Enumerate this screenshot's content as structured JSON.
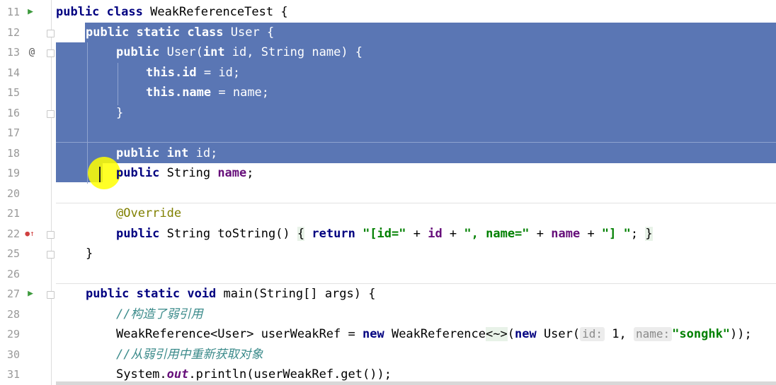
{
  "editor": {
    "lines": [
      {
        "num": "11"
      },
      {
        "num": "12"
      },
      {
        "num": "13"
      },
      {
        "num": "14"
      },
      {
        "num": "15"
      },
      {
        "num": "16"
      },
      {
        "num": "17"
      },
      {
        "num": "18"
      },
      {
        "num": "19"
      },
      {
        "num": "20"
      },
      {
        "num": "21"
      },
      {
        "num": "22"
      },
      {
        "num": "25"
      },
      {
        "num": "26"
      },
      {
        "num": "27"
      },
      {
        "num": "28"
      },
      {
        "num": "29"
      },
      {
        "num": "30"
      },
      {
        "num": "31"
      }
    ],
    "gutter_icons": {
      "run_11": "▶",
      "override_13": "@",
      "run_27": "▶",
      "override_22": "●↑"
    },
    "code": {
      "l11_public": "public",
      "l11_class": "class",
      "l11_name": " WeakReferenceTest {",
      "l12_public": "public",
      "l12_static": "static",
      "l12_class": "class",
      "l12_name": " User {",
      "l13_public": "public",
      "l13_sig1": " User(",
      "l13_int": "int",
      "l13_sig2": " id, String name) {",
      "l14_this": "this",
      "l14_id": ".id",
      "l14_rest": " = id;",
      "l15_this": "this",
      "l15_name": ".name",
      "l15_rest": " = name;",
      "l16_brace": "}",
      "l18_public": "public",
      "l18_int": "int",
      "l18_id": " id;",
      "l19_public": "public",
      "l19_type": " String ",
      "l19_name": "name",
      "l19_semi": ";",
      "l21_ann": "@Override",
      "l22_public": "public",
      "l22_sig": " String toString() ",
      "l22_lb": "{",
      "l22_return": "return",
      "l22_s1": "\"[id=\"",
      "l22_plus1": " + ",
      "l22_id": "id",
      "l22_plus2": " + ",
      "l22_s2": "\", name=\"",
      "l22_plus3": " + ",
      "l22_name": "name",
      "l22_plus4": " + ",
      "l22_s3": "\"] \"",
      "l22_semi": ";",
      "l22_rb": "}",
      "l25_brace": "}",
      "l27_public": "public",
      "l27_static": "static",
      "l27_void": "void",
      "l27_sig": " main(String[] args) {",
      "l28_comment": "//构造了弱引用",
      "l29_p1": "WeakReference<User> userWeakRef = ",
      "l29_new1": "new",
      "l29_p2": " WeakReference",
      "l29_diamond": "<~>",
      "l29_p3": "(",
      "l29_new2": "new",
      "l29_p4": " User(",
      "l29_hint_id": "id:",
      "l29_one": " 1, ",
      "l29_hint_name": "name:",
      "l29_str": "\"songhk\"",
      "l29_end": "));",
      "l30_comment": "//从弱引用中重新获取对象",
      "l31_p1": "System.",
      "l31_out": "out",
      "l31_p2": ".println(userWeakRef.get());"
    }
  }
}
